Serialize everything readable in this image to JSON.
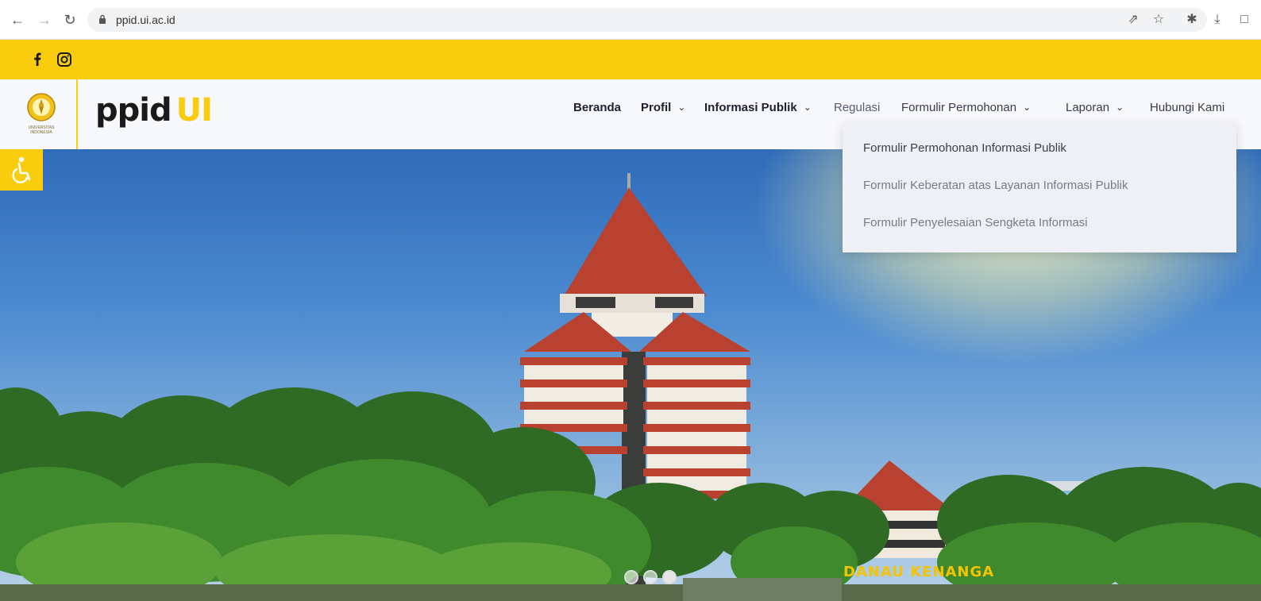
{
  "browser": {
    "url": "ppid.ui.ac.id",
    "nav_icons": [
      "back-icon",
      "forward-icon",
      "reload-icon"
    ],
    "right_icons": [
      "share-icon",
      "star-icon",
      "extensions-icon",
      "download-icon",
      "window-icon"
    ]
  },
  "social": {
    "items": [
      "facebook-icon",
      "instagram-icon"
    ],
    "bar_color": "#f9cd0e"
  },
  "header": {
    "crest_text": "UNIVERSITAS INDONESIA",
    "brand_ppid": "ppid",
    "brand_ui": "UI",
    "menu": {
      "beranda": "Beranda",
      "profil": "Profil",
      "informasi_publik": "Informasi Publik",
      "regulasi": "Regulasi",
      "formulir_permohonan": "Formulir Permohonan",
      "laporan": "Laporan",
      "hubungi_kami": "Hubungi Kami"
    }
  },
  "dropdown": {
    "items": [
      "Formulir Permohonan Informasi Publik",
      "Formulir Keberatan atas Layanan Informasi Publik",
      "Formulir Penyelesaian Sengketa Informasi"
    ]
  },
  "hero": {
    "sign_text": "DANAU KENANGA",
    "slides": 3,
    "active_slide": 3
  },
  "accessibility": {
    "icon": "accessibility-icon"
  }
}
